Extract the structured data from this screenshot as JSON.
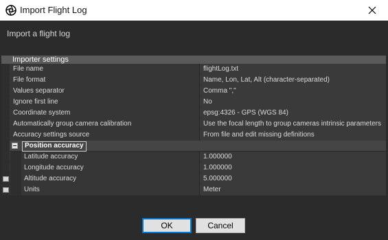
{
  "window": {
    "title": "Import Flight Log"
  },
  "subtitle": "Import a flight log",
  "grid": {
    "header": "Importer settings",
    "rows": [
      {
        "name": "File name",
        "value": "flightLog.txt"
      },
      {
        "name": "File format",
        "value": "Name, Lon, Lat, Alt (character-separated)"
      },
      {
        "name": "Values separator",
        "value": "Comma \",\""
      },
      {
        "name": "Ignore first line",
        "value": "No"
      },
      {
        "name": "Coordinate system",
        "value": "epsg:4326 - GPS (WGS 84)"
      },
      {
        "name": "Automatically group camera calibration",
        "value": "Use the focal length to group cameras intrinsic parameters"
      },
      {
        "name": "Accuracy settings source",
        "value": "From file and edit missing definitions"
      }
    ],
    "group": {
      "label": "Position accuracy",
      "rows": [
        {
          "name": "Latitude accuracy",
          "value": "1.000000"
        },
        {
          "name": "Longitude accuracy",
          "value": "1.000000"
        },
        {
          "name": "Altitude accuracy",
          "value": "5.000000"
        },
        {
          "name": "Units",
          "value": "Meter"
        }
      ]
    }
  },
  "buttons": {
    "ok": "OK",
    "cancel": "Cancel"
  }
}
